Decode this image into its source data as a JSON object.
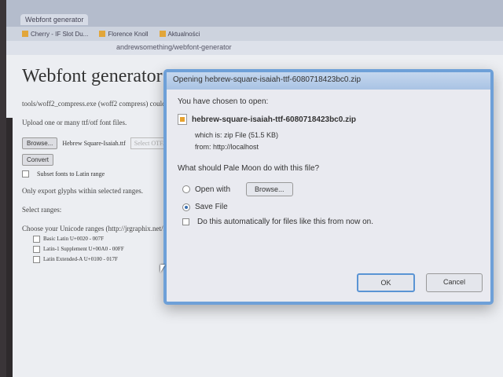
{
  "browser": {
    "tabs": [
      "Webfont generator"
    ],
    "bookmarks": [
      "Cherry - IF Slot Du...",
      "Florence Knoll",
      "Aktualności"
    ],
    "url": "andrewsomething/webfont-generator"
  },
  "page": {
    "title": "Webfont generator",
    "compress_note": "tools/woff2_compress.exe (woff2 compress) could",
    "upload_label": "Upload one or many ttf/otf font files.",
    "browse_button": "Browse...",
    "selected_file": "Hebrew Square-Isaiah.ttf",
    "select_placeholder": "Select OTF/TTF",
    "convert_button": "Convert",
    "subset_label": "Subset fonts to Latin range",
    "only_export": "Only export glyphs within selected ranges.",
    "select_ranges": "Select ranges:",
    "choose_ranges": "Choose your Unicode ranges (http://jrgraphix.net/research/unicode.php).",
    "ranges": [
      "Basic Latin U+0020 - 007F",
      "Latin-1 Supplement U+00A0 - 00FF",
      "Latin Extended-A U+0100 - 017F"
    ]
  },
  "dialog": {
    "title": "Opening hebrew-square-isaiah-ttf-6080718423bc0.zip",
    "chosen_label": "You have chosen to open:",
    "filename": "hebrew-square-isaiah-ttf-6080718423bc0.zip",
    "which_is": "which is: zip File (51.5 KB)",
    "from": "from: http://localhost",
    "question": "What should Pale Moon do with this file?",
    "open_with_label": "Open with",
    "browse_button": "Browse...",
    "save_file_label": "Save File",
    "selected_option": "Save File",
    "auto_label": "Do this automatically for files like this from now on.",
    "ok_button": "OK",
    "cancel_button": "Cancel"
  }
}
